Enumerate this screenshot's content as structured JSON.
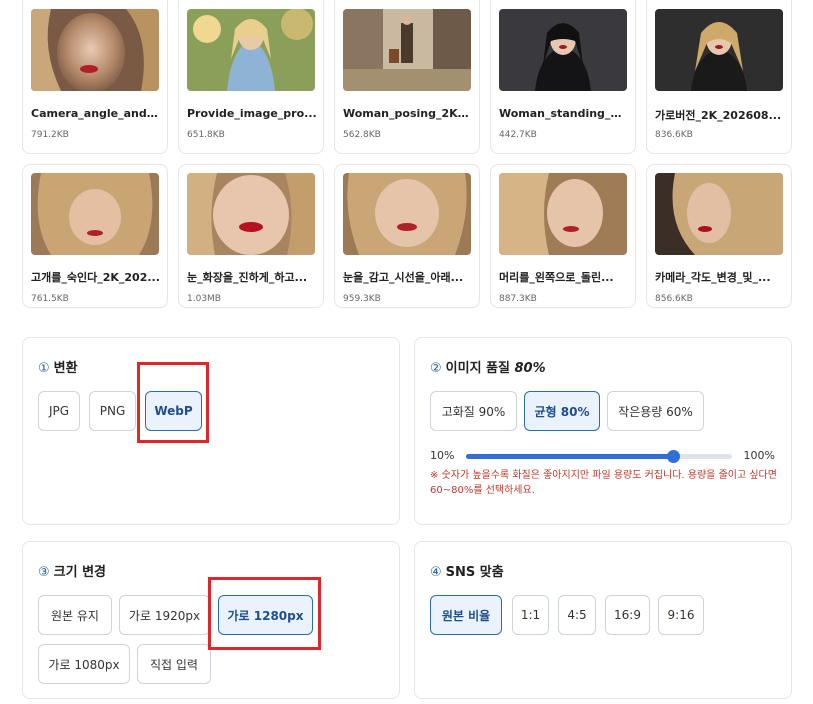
{
  "images": [
    {
      "name": "Camera_angle_and_h...",
      "size": "791.2KB",
      "thumb": "woman-portrait-red-lips"
    },
    {
      "name": "Provide_image_pro...",
      "size": "651.8KB",
      "thumb": "woman-garden-denim"
    },
    {
      "name": "Woman_posing_2K_...",
      "size": "562.8KB",
      "thumb": "woman-street-suitcase"
    },
    {
      "name": "Woman_standing_2...",
      "size": "442.7KB",
      "thumb": "woman-black-dress"
    },
    {
      "name": "가로버전_2K_202608...",
      "size": "836.6KB",
      "thumb": "woman-portrait-blonde"
    },
    {
      "name": "고개를_숙인다_2K_202...",
      "size": "761.5KB",
      "thumb": "woman-head-down"
    },
    {
      "name": "눈_화장을_진하게_하고...",
      "size": "1.03MB",
      "thumb": "woman-closeup-lips"
    },
    {
      "name": "눈을_감고_시선을_아래...",
      "size": "959.3KB",
      "thumb": "woman-eyes-closed"
    },
    {
      "name": "머리를_왼쪽으로_돌린...",
      "size": "887.3KB",
      "thumb": "woman-head-turned"
    },
    {
      "name": "카메라_각도_변경_및_...",
      "size": "856.6KB",
      "thumb": "woman-side-angle"
    }
  ],
  "convert": {
    "num": "①",
    "title": "변환",
    "options": [
      "JPG",
      "PNG",
      "WebP"
    ],
    "selected": "WebP"
  },
  "quality": {
    "num": "②",
    "title": "이미지 품질",
    "value_label": "80%",
    "options": [
      "고화질 90%",
      "균형 80%",
      "작은용량 60%"
    ],
    "selected": "균형 80%",
    "slider_min_label": "10%",
    "slider_max_label": "100%",
    "slider_min": 10,
    "slider_max": 100,
    "slider_value": 80,
    "note": "※ 숫자가 높을수록 화질은 좋아지지만 파일 용량도 커집니다. 용량을 줄이고 싶다면 60~80%를 선택하세요."
  },
  "resize": {
    "num": "③",
    "title": "크기 변경",
    "options": [
      "원본 유지",
      "가로 1920px",
      "가로 1280px",
      "가로 1080px",
      "직접 입력"
    ],
    "selected": "가로 1280px"
  },
  "sns": {
    "num": "④",
    "title": "SNS 맞춤",
    "options": [
      "원본 비율",
      "1:1",
      "4:5",
      "16:9",
      "9:16"
    ],
    "selected": "원본 비율"
  },
  "colors": {
    "accent": "#2b6cb0",
    "slider": "#2f6fd6",
    "highlight": "#e0262a",
    "note": "#c0392b"
  }
}
